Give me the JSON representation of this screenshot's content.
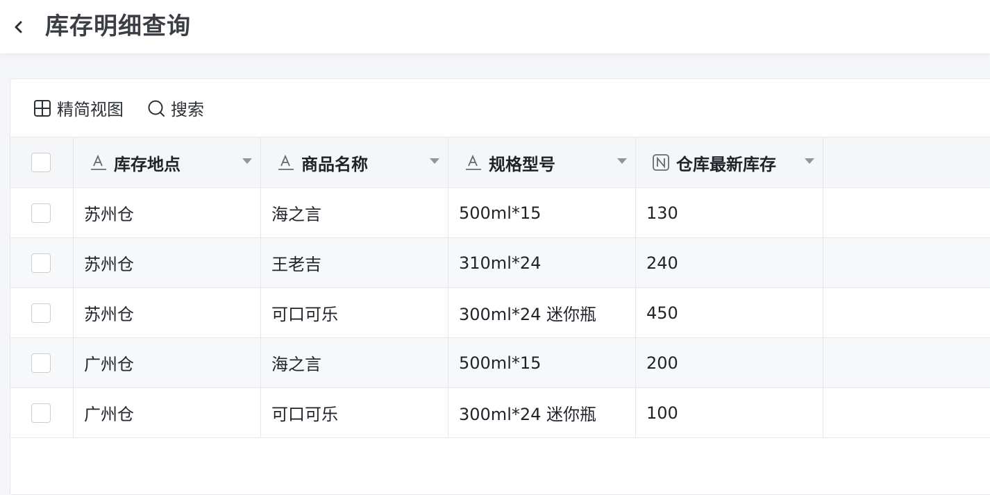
{
  "header": {
    "title": "库存明细查询"
  },
  "toolbar": {
    "compact_view_label": "精简视图",
    "search_label": "搜索"
  },
  "table": {
    "columns": [
      {
        "label": "库存地点",
        "type_icon": "text-field-icon"
      },
      {
        "label": "商品名称",
        "type_icon": "text-field-icon"
      },
      {
        "label": "规格型号",
        "type_icon": "text-field-icon"
      },
      {
        "label": "仓库最新库存",
        "type_icon": "number-field-icon"
      }
    ],
    "rows": [
      [
        "苏州仓",
        "海之言",
        "500ml*15",
        "130"
      ],
      [
        "苏州仓",
        "王老吉",
        "310ml*24",
        "240"
      ],
      [
        "苏州仓",
        "可口可乐",
        "300ml*24 迷你瓶",
        "450"
      ],
      [
        "广州仓",
        "海之言",
        "500ml*15",
        "200"
      ],
      [
        "广州仓",
        "可口可乐",
        "300ml*24 迷你瓶",
        "100"
      ]
    ]
  },
  "colors": {
    "header_bg": "#ffffff",
    "page_bg": "#f5f6f8",
    "border": "#e5e7eb",
    "text": "#1f2329"
  }
}
